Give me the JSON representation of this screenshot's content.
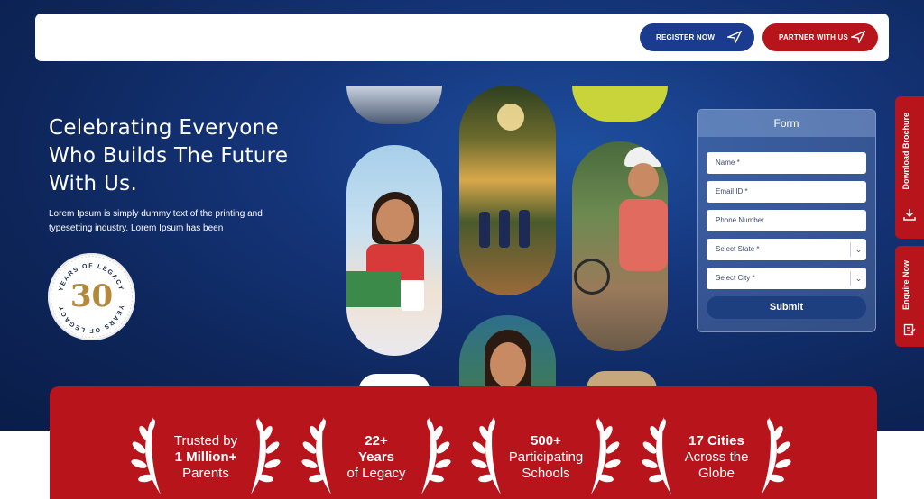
{
  "nav": {
    "register_label": "REGISTER NOW",
    "partner_label": "PARTNER WITH US"
  },
  "hero": {
    "headline_line1": "Celebrating Everyone",
    "headline_line2": "Who Builds The Future",
    "headline_line3": "With Us.",
    "subtext": "Lorem Ipsum is simply dummy text of the printing and typesetting industry. Lorem Ipsum has been",
    "badge": {
      "number": "30",
      "ring_text_top": "YEARS OF LEGACY",
      "ring_text_bottom": "YEARS OF LEGACY"
    }
  },
  "form": {
    "title": "Form",
    "fields": [
      {
        "placeholder": "Name *"
      },
      {
        "placeholder": "Email ID *"
      },
      {
        "placeholder": "Phone Number"
      },
      {
        "placeholder": "Select State *"
      },
      {
        "placeholder": "Select City *"
      }
    ],
    "submit_label": "Submit"
  },
  "side_tabs": {
    "download_label": "Download Brochure",
    "enquire_label": "Enquire Now"
  },
  "stats": [
    {
      "line1": "Trusted by",
      "line2": "1 Million+",
      "line3": "Parents"
    },
    {
      "line1": "22+",
      "line2": "Years",
      "line3": "of Legacy"
    },
    {
      "line1": "500+",
      "line2": "Participating",
      "line3": "Schools"
    },
    {
      "line1": "17 Cities",
      "line2": "Across the",
      "line3": "Globe"
    }
  ],
  "colors": {
    "navy": "#0d2559",
    "accent_red": "#b8141c",
    "button_blue": "#1b3c8e",
    "gold": "#b38a3d"
  }
}
